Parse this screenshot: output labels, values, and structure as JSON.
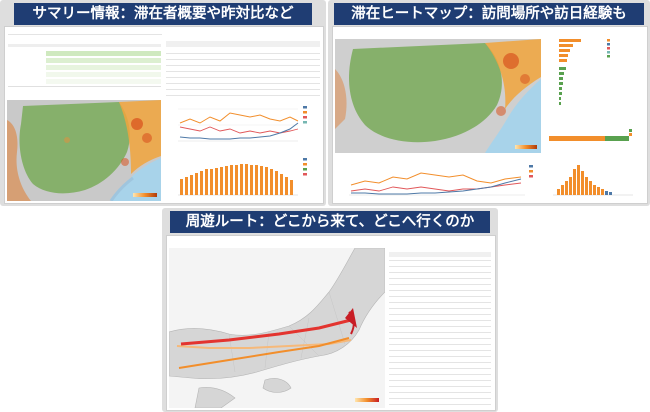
{
  "panels": {
    "summary": {
      "title": "サマリー情報：滞在者概要や昨対比など"
    },
    "heatmap": {
      "title": "滞在ヒートマップ：訪問場所や訪日経験も"
    },
    "route": {
      "title": "周遊ルート：どこから来て、どこへ行くのか"
    }
  },
  "colors": {
    "banner": "#1f3d73",
    "map_land": "#86b06b",
    "map_highlight": "#f1a43c",
    "orange": "#f28e2b",
    "blue": "#4e79a7",
    "route_red": "#e3342f",
    "panel_bg": "#dedede"
  }
}
